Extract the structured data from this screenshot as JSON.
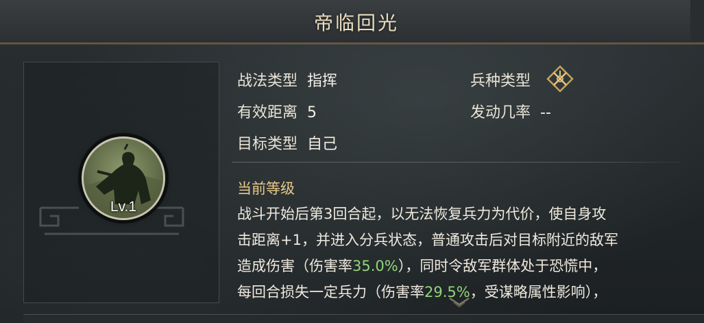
{
  "title": "帝临回光",
  "portrait": {
    "level_label": "Lv.1"
  },
  "fields": {
    "tactic_type_label": "战法类型",
    "tactic_type_value": "指挥",
    "troop_type_label": "兵种类型",
    "effective_range_label": "有效距离",
    "effective_range_value": "5",
    "trigger_rate_label": "发动几率",
    "trigger_rate_value": "--",
    "target_type_label": "目标类型",
    "target_type_value": "自己"
  },
  "section": {
    "current_level_label": "当前等级"
  },
  "description": {
    "line1": "战斗开始后第3回合起，以无法恢复兵力为代价，使自身攻",
    "line2": "击距离+1，并进入分兵状态，普通攻击后对目标附近的敌军",
    "line3_a": "造成伤害（伤害率",
    "line3_pct": "35.0%",
    "line3_b": "），同时令敌军群体处于恐慌中，",
    "line4_a": "每回合损失一定兵力（伤害率",
    "line4_pct": "29.5%",
    "line4_b": "，受谋略属性影响），"
  },
  "icons": {
    "troop_type_icon": "crossed-weapons-diamond-icon",
    "scroll_hint_icon": "chevron-down-icon"
  },
  "colors": {
    "highlight": "#8fd77a",
    "section_title": "#e8c98a",
    "title_border": "#6b5a3e"
  }
}
